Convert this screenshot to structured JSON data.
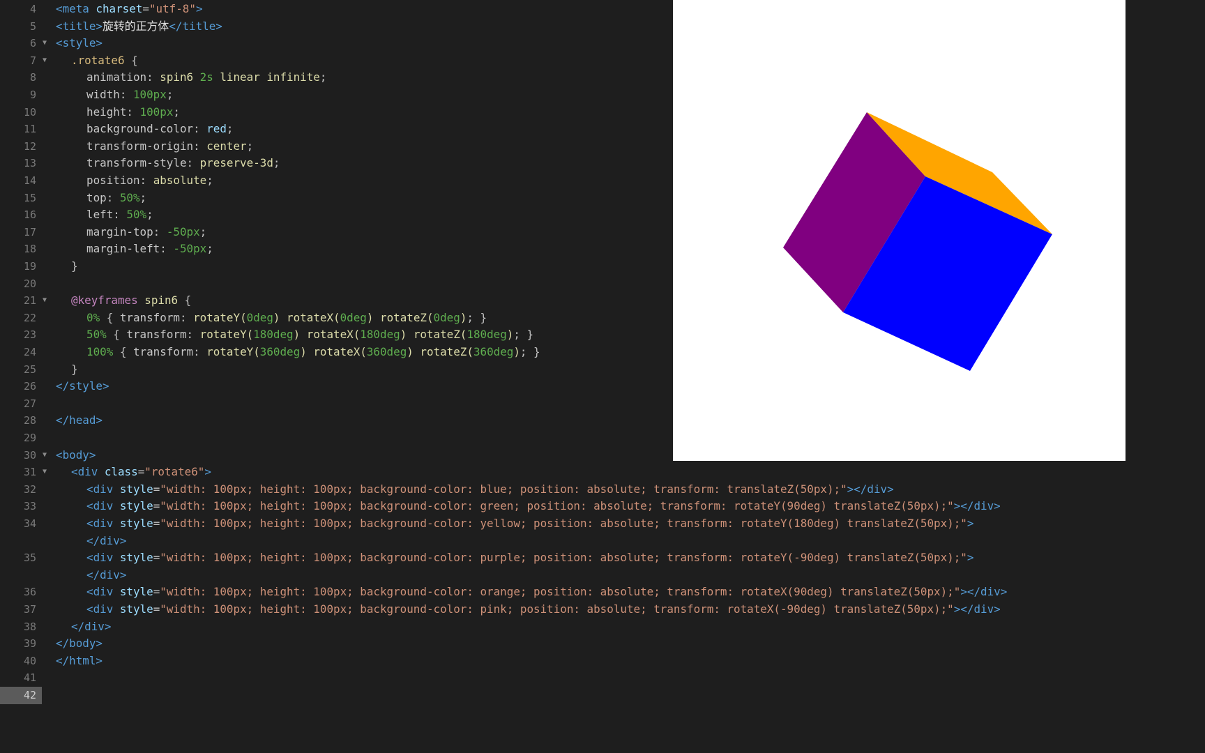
{
  "editor": {
    "lines": [
      {
        "num": "4",
        "fold": "",
        "indent": 0,
        "tokens": [
          [
            "tag",
            "<meta "
          ],
          [
            "attr",
            "charset"
          ],
          [
            "punct",
            "="
          ],
          [
            "str",
            "\"utf-8\""
          ],
          [
            "tag",
            ">"
          ]
        ]
      },
      {
        "num": "5",
        "fold": "",
        "indent": 0,
        "tokens": [
          [
            "tag",
            "<title>"
          ],
          [
            "zh",
            "旋转的正方体"
          ],
          [
            "tag",
            "</title>"
          ]
        ]
      },
      {
        "num": "6",
        "fold": "▼",
        "indent": 0,
        "tokens": [
          [
            "tag",
            "<style>"
          ]
        ]
      },
      {
        "num": "7",
        "fold": "▼",
        "indent": 1,
        "tokens": [
          [
            "sel",
            ".rotate6 "
          ],
          [
            "punct",
            "{"
          ]
        ]
      },
      {
        "num": "8",
        "fold": "",
        "indent": 2,
        "tokens": [
          [
            "prop",
            "animation"
          ],
          [
            "punct",
            ": "
          ],
          [
            "val",
            "spin6 "
          ],
          [
            "num",
            "2s "
          ],
          [
            "val",
            "linear infinite"
          ],
          [
            "punct",
            ";"
          ]
        ]
      },
      {
        "num": "9",
        "fold": "",
        "indent": 2,
        "tokens": [
          [
            "prop",
            "width"
          ],
          [
            "punct",
            ": "
          ],
          [
            "num",
            "100px"
          ],
          [
            "punct",
            ";"
          ]
        ]
      },
      {
        "num": "10",
        "fold": "",
        "indent": 2,
        "tokens": [
          [
            "prop",
            "height"
          ],
          [
            "punct",
            ": "
          ],
          [
            "num",
            "100px"
          ],
          [
            "punct",
            ";"
          ]
        ]
      },
      {
        "num": "11",
        "fold": "",
        "indent": 2,
        "tokens": [
          [
            "prop",
            "background-color"
          ],
          [
            "punct",
            ": "
          ],
          [
            "attr",
            "red"
          ],
          [
            "punct",
            ";"
          ]
        ]
      },
      {
        "num": "12",
        "fold": "",
        "indent": 2,
        "tokens": [
          [
            "prop",
            "transform-origin"
          ],
          [
            "punct",
            ": "
          ],
          [
            "val",
            "center"
          ],
          [
            "punct",
            ";"
          ]
        ]
      },
      {
        "num": "13",
        "fold": "",
        "indent": 2,
        "tokens": [
          [
            "prop",
            "transform-style"
          ],
          [
            "punct",
            ": "
          ],
          [
            "val",
            "preserve-3d"
          ],
          [
            "punct",
            ";"
          ]
        ]
      },
      {
        "num": "14",
        "fold": "",
        "indent": 2,
        "tokens": [
          [
            "prop",
            "position"
          ],
          [
            "punct",
            ": "
          ],
          [
            "val",
            "absolute"
          ],
          [
            "punct",
            ";"
          ]
        ]
      },
      {
        "num": "15",
        "fold": "",
        "indent": 2,
        "tokens": [
          [
            "prop",
            "top"
          ],
          [
            "punct",
            ": "
          ],
          [
            "num",
            "50%"
          ],
          [
            "punct",
            ";"
          ]
        ]
      },
      {
        "num": "16",
        "fold": "",
        "indent": 2,
        "tokens": [
          [
            "prop",
            "left"
          ],
          [
            "punct",
            ": "
          ],
          [
            "num",
            "50%"
          ],
          [
            "punct",
            ";"
          ]
        ]
      },
      {
        "num": "17",
        "fold": "",
        "indent": 2,
        "tokens": [
          [
            "prop",
            "margin-top"
          ],
          [
            "punct",
            ": "
          ],
          [
            "num",
            "-50px"
          ],
          [
            "punct",
            ";"
          ]
        ]
      },
      {
        "num": "18",
        "fold": "",
        "indent": 2,
        "tokens": [
          [
            "prop",
            "margin-left"
          ],
          [
            "punct",
            ": "
          ],
          [
            "num",
            "-50px"
          ],
          [
            "punct",
            ";"
          ]
        ]
      },
      {
        "num": "19",
        "fold": "",
        "indent": 1,
        "tokens": [
          [
            "punct",
            "}"
          ]
        ]
      },
      {
        "num": "20",
        "fold": "",
        "indent": 0,
        "tokens": []
      },
      {
        "num": "21",
        "fold": "▼",
        "indent": 1,
        "tokens": [
          [
            "kw",
            "@keyframes "
          ],
          [
            "val",
            "spin6 "
          ],
          [
            "punct",
            "{"
          ]
        ]
      },
      {
        "num": "22",
        "fold": "",
        "indent": 2,
        "tokens": [
          [
            "num",
            "0% "
          ],
          [
            "punct",
            "{ "
          ],
          [
            "prop",
            "transform"
          ],
          [
            "punct",
            ": "
          ],
          [
            "val",
            "rotateY("
          ],
          [
            "num",
            "0deg"
          ],
          [
            "val",
            ") rotateX("
          ],
          [
            "num",
            "0deg"
          ],
          [
            "val",
            ") rotateZ("
          ],
          [
            "num",
            "0deg"
          ],
          [
            "val",
            ")"
          ],
          [
            "punct",
            "; }"
          ]
        ]
      },
      {
        "num": "23",
        "fold": "",
        "indent": 2,
        "tokens": [
          [
            "num",
            "50% "
          ],
          [
            "punct",
            "{ "
          ],
          [
            "prop",
            "transform"
          ],
          [
            "punct",
            ": "
          ],
          [
            "val",
            "rotateY("
          ],
          [
            "num",
            "180deg"
          ],
          [
            "val",
            ") rotateX("
          ],
          [
            "num",
            "180deg"
          ],
          [
            "val",
            ") rotateZ("
          ],
          [
            "num",
            "180deg"
          ],
          [
            "val",
            ")"
          ],
          [
            "punct",
            "; }"
          ]
        ]
      },
      {
        "num": "24",
        "fold": "",
        "indent": 2,
        "tokens": [
          [
            "num",
            "100% "
          ],
          [
            "punct",
            "{ "
          ],
          [
            "prop",
            "transform"
          ],
          [
            "punct",
            ": "
          ],
          [
            "val",
            "rotateY("
          ],
          [
            "num",
            "360deg"
          ],
          [
            "val",
            ") rotateX("
          ],
          [
            "num",
            "360deg"
          ],
          [
            "val",
            ") rotateZ("
          ],
          [
            "num",
            "360deg"
          ],
          [
            "val",
            ")"
          ],
          [
            "punct",
            "; }"
          ]
        ]
      },
      {
        "num": "25",
        "fold": "",
        "indent": 1,
        "tokens": [
          [
            "punct",
            "}"
          ]
        ]
      },
      {
        "num": "26",
        "fold": "",
        "indent": 0,
        "tokens": [
          [
            "tag",
            "</style>"
          ]
        ]
      },
      {
        "num": "27",
        "fold": "",
        "indent": 0,
        "tokens": []
      },
      {
        "num": "28",
        "fold": "",
        "indent": 0,
        "tokens": [
          [
            "tag",
            "</head>"
          ]
        ]
      },
      {
        "num": "29",
        "fold": "",
        "indent": 0,
        "tokens": []
      },
      {
        "num": "30",
        "fold": "▼",
        "indent": 0,
        "tokens": [
          [
            "tag",
            "<body>"
          ]
        ]
      },
      {
        "num": "31",
        "fold": "▼",
        "indent": 1,
        "tokens": [
          [
            "tag",
            "<div "
          ],
          [
            "attr",
            "class"
          ],
          [
            "punct",
            "="
          ],
          [
            "str",
            "\"rotate6\""
          ],
          [
            "tag",
            ">"
          ]
        ]
      },
      {
        "num": "32",
        "fold": "",
        "indent": 2,
        "tokens": [
          [
            "tag",
            "<div "
          ],
          [
            "attr",
            "style"
          ],
          [
            "punct",
            "="
          ],
          [
            "str",
            "\"width: 100px; height: 100px; background-color: blue; position: absolute; transform: translateZ(50px);\""
          ],
          [
            "tag",
            "></div>"
          ]
        ]
      },
      {
        "num": "33",
        "fold": "",
        "indent": 2,
        "tokens": [
          [
            "tag",
            "<div "
          ],
          [
            "attr",
            "style"
          ],
          [
            "punct",
            "="
          ],
          [
            "str",
            "\"width: 100px; height: 100px; background-color: green; position: absolute; transform: rotateY(90deg) translateZ(50px);\""
          ],
          [
            "tag",
            "></div>"
          ]
        ]
      },
      {
        "num": "34",
        "fold": "",
        "indent": 2,
        "tokens": [
          [
            "tag",
            "<div "
          ],
          [
            "attr",
            "style"
          ],
          [
            "punct",
            "="
          ],
          [
            "str",
            "\"width: 100px; height: 100px; background-color: yellow; position: absolute; transform: rotateY(180deg) translateZ(50px);\""
          ],
          [
            "tag",
            ">"
          ]
        ]
      },
      {
        "num": "",
        "fold": "",
        "indent": 2,
        "tokens": [
          [
            "tag",
            "</div>"
          ]
        ]
      },
      {
        "num": "35",
        "fold": "",
        "indent": 2,
        "tokens": [
          [
            "tag",
            "<div "
          ],
          [
            "attr",
            "style"
          ],
          [
            "punct",
            "="
          ],
          [
            "str",
            "\"width: 100px; height: 100px; background-color: purple; position: absolute; transform: rotateY(-90deg) translateZ(50px);\""
          ],
          [
            "tag",
            ">"
          ]
        ]
      },
      {
        "num": "",
        "fold": "",
        "indent": 2,
        "tokens": [
          [
            "tag",
            "</div>"
          ]
        ]
      },
      {
        "num": "36",
        "fold": "",
        "indent": 2,
        "tokens": [
          [
            "tag",
            "<div "
          ],
          [
            "attr",
            "style"
          ],
          [
            "punct",
            "="
          ],
          [
            "str",
            "\"width: 100px; height: 100px; background-color: orange; position: absolute; transform: rotateX(90deg) translateZ(50px);\""
          ],
          [
            "tag",
            "></div>"
          ]
        ]
      },
      {
        "num": "37",
        "fold": "",
        "indent": 2,
        "tokens": [
          [
            "tag",
            "<div "
          ],
          [
            "attr",
            "style"
          ],
          [
            "punct",
            "="
          ],
          [
            "str",
            "\"width: 100px; height: 100px; background-color: pink; position: absolute; transform: rotateX(-90deg) translateZ(50px);\""
          ],
          [
            "tag",
            "></div>"
          ]
        ]
      },
      {
        "num": "38",
        "fold": "",
        "indent": 1,
        "tokens": [
          [
            "tag",
            "</div>"
          ]
        ]
      },
      {
        "num": "39",
        "fold": "",
        "indent": 0,
        "tokens": [
          [
            "tag",
            "</body>"
          ]
        ]
      },
      {
        "num": "40",
        "fold": "",
        "indent": 0,
        "tokens": [
          [
            "tag",
            "</html>"
          ]
        ]
      },
      {
        "num": "41",
        "fold": "",
        "indent": 0,
        "tokens": []
      },
      {
        "num": "42",
        "fold": "",
        "indent": 0,
        "tokens": [],
        "active": true
      }
    ]
  },
  "preview": {
    "background": "#ffffff",
    "faces": [
      {
        "name": "purple-face",
        "color": "#800080"
      },
      {
        "name": "orange-face",
        "color": "#ffa500"
      },
      {
        "name": "blue-face",
        "color": "#0000ff"
      }
    ]
  }
}
